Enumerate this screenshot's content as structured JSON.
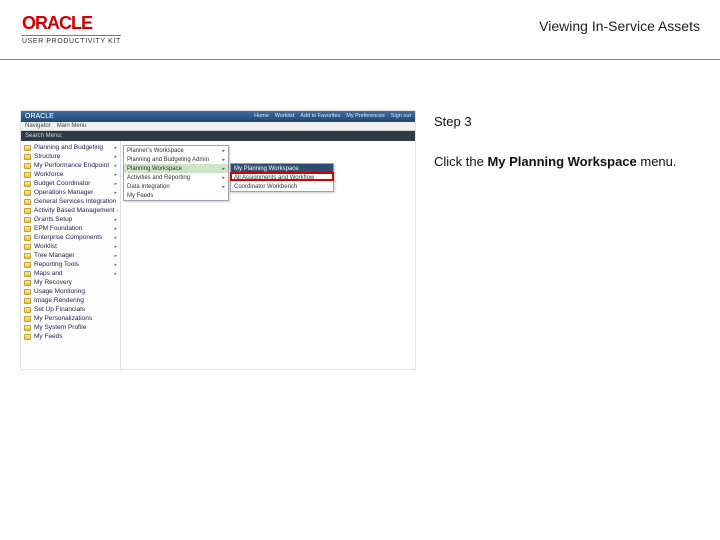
{
  "header": {
    "logo_text": "ORACLE",
    "product": "USER PRODUCTIVITY KIT",
    "page_title": "Viewing In-Service Assets"
  },
  "step": {
    "label": "Step 3",
    "text_before": "Click the ",
    "bold": "My Planning Workspace",
    "text_after": " menu."
  },
  "shot": {
    "topbar_brand": "ORACLE",
    "menubar": [
      "Navigator",
      "Main Menu"
    ],
    "topnav": [
      "Home",
      "Worklist",
      "Add to Favorites",
      "My Preferences",
      "Sign out"
    ],
    "searchbar": "Search Menu:",
    "left_folders": [
      "Planning and Budgeting",
      "Structure",
      "My Performance Endpoint",
      "Workforce",
      "Budget Coordinator",
      "Operations Manager",
      "General Services Integration",
      "Activity Based Management",
      "Grants Setup",
      "EPM Foundation",
      "Enterprise Components",
      "Worklist",
      "Tree Manager",
      "Reporting Tools",
      "Maps and",
      "My Recovery",
      "Usage Monitoring",
      "Image Rendering",
      "Set Up Financials",
      "My Personalizations",
      "My System Profile",
      "My Feeds"
    ],
    "submenu1": [
      "Planner’s Workspace",
      "Planning and Budgeting Admin",
      "Planning Workspace",
      "Activities and Reporting",
      "Data Integration",
      "My Feeds"
    ],
    "submenu2": [
      "My Planning Workspace",
      "All Assignments and Workflow",
      "Coordinator Workbench"
    ]
  }
}
